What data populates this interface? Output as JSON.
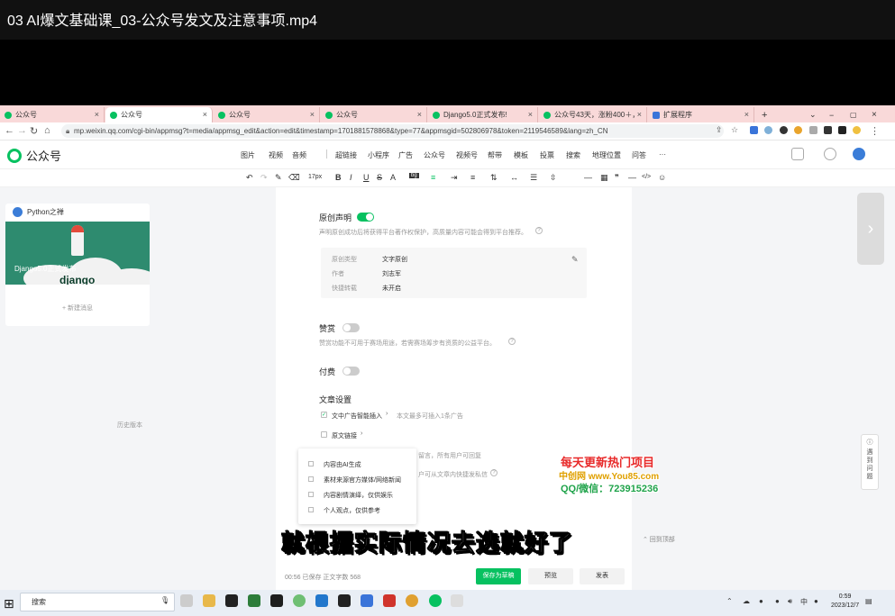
{
  "video": {
    "title": "03 AI爆文基础课_03-公众号发文及注意事项.mp4"
  },
  "browser": {
    "tabs": [
      {
        "label": "公众号",
        "color": "#07c160"
      },
      {
        "label": "公众号",
        "color": "#07c160"
      },
      {
        "label": "公众号",
        "color": "#07c160"
      },
      {
        "label": "公众号",
        "color": "#07c160"
      },
      {
        "label": "Django5.0正式发布!",
        "color": "#07c160"
      },
      {
        "label": "公众号43天，涨粉400＋，爆…",
        "color": "#07c160"
      },
      {
        "label": "扩展程序",
        "color": "#3a74d9"
      }
    ],
    "url": "mp.weixin.qq.com/cgi-bin/appmsg?t=media/appmsg_edit&action=edit&timestamp=1701881578868&type=77&appmsgid=502806978&token=2119546589&lang=zh_CN"
  },
  "header": {
    "logo": "公众号",
    "menu": [
      "图片",
      "视频",
      "音频",
      "超链接",
      "小程序",
      "广告",
      "公众号",
      "视频号",
      "帮带",
      "模板",
      "投票",
      "搜索",
      "地理位置",
      "问答",
      "···"
    ]
  },
  "toolbar": {
    "font_size": "17px"
  },
  "sidebar": {
    "account": "Python之禅",
    "cover_text": "Django5.0正式发布",
    "cover_brand": "django",
    "new_message": "+ 新建消息",
    "history": "历史版本"
  },
  "original": {
    "title": "原创声明",
    "desc": "声明原创成功后将获得平台著作权保护，高质量内容可能会得到平台推荐。",
    "fields": [
      {
        "k": "原创类型",
        "v": "文字原创"
      },
      {
        "k": "作者",
        "v": "刘志军"
      },
      {
        "k": "快捷转载",
        "v": "未开启"
      }
    ]
  },
  "reward": {
    "title": "赞赏",
    "desc": "赞赏功能不可用于赛场用途，若需赛场筹步有资质的公益平台。"
  },
  "paid": {
    "title": "付费"
  },
  "settings": {
    "title": "文章设置",
    "ad_label": "文中广告智能插入",
    "ad_desc": "本文最多可插入1条广告",
    "source_label": "原文链接",
    "comment_desc": "留言，所有用户可回复",
    "hidden_desc": "户可从文章内快捷发私信"
  },
  "dropdown": {
    "items": [
      "内容由AI生成",
      "素材来源官方媒体/网络新闻",
      "内容剧情演绎，仅供娱乐",
      "个人观点，仅供参考"
    ]
  },
  "footer": {
    "status": "00:56 已保存  正文字数 568",
    "save": "保存为草稿",
    "preview": "预览",
    "publish": "发表",
    "back_top": "⌃ 回到顶部"
  },
  "watermark": {
    "line1": "每天更新热门项目",
    "line2": "中创网 www.You85.com",
    "line3": "QQ/微信：723915236"
  },
  "subtitle": "就根据实际情况去选就好了",
  "help": {
    "label": "遇到问题"
  },
  "taskbar": {
    "search": "搜索",
    "ime": "中",
    "time": "0:59",
    "date": "2023/12/7"
  }
}
